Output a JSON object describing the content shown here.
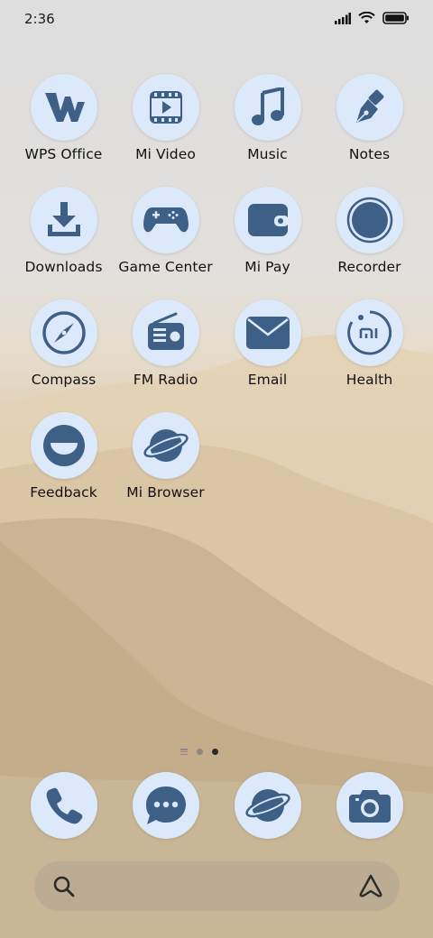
{
  "status_bar": {
    "time": "2:36"
  },
  "apps": [
    {
      "label": "WPS Office",
      "icon": "wps-office-icon"
    },
    {
      "label": "Mi Video",
      "icon": "video-icon"
    },
    {
      "label": "Music",
      "icon": "music-note-icon"
    },
    {
      "label": "Notes",
      "icon": "pen-icon"
    },
    {
      "label": "Downloads",
      "icon": "download-icon"
    },
    {
      "label": "Game Center",
      "icon": "gamepad-icon"
    },
    {
      "label": "Mi Pay",
      "icon": "wallet-icon"
    },
    {
      "label": "Recorder",
      "icon": "record-circle-icon"
    },
    {
      "label": "Compass",
      "icon": "compass-icon"
    },
    {
      "label": "FM Radio",
      "icon": "radio-icon"
    },
    {
      "label": "Email",
      "icon": "envelope-icon"
    },
    {
      "label": "Health",
      "icon": "health-icon"
    },
    {
      "label": "Feedback",
      "icon": "smile-icon"
    },
    {
      "label": "Mi Browser",
      "icon": "planet-icon"
    }
  ],
  "dock": [
    {
      "icon": "phone-icon"
    },
    {
      "icon": "chat-bubble-icon"
    },
    {
      "icon": "planet-icon"
    },
    {
      "icon": "camera-icon"
    }
  ],
  "pager": {
    "pages": 2,
    "active": 2
  },
  "colors": {
    "icon_bg": "#dce9fb",
    "glyph": "#3e5f86"
  }
}
